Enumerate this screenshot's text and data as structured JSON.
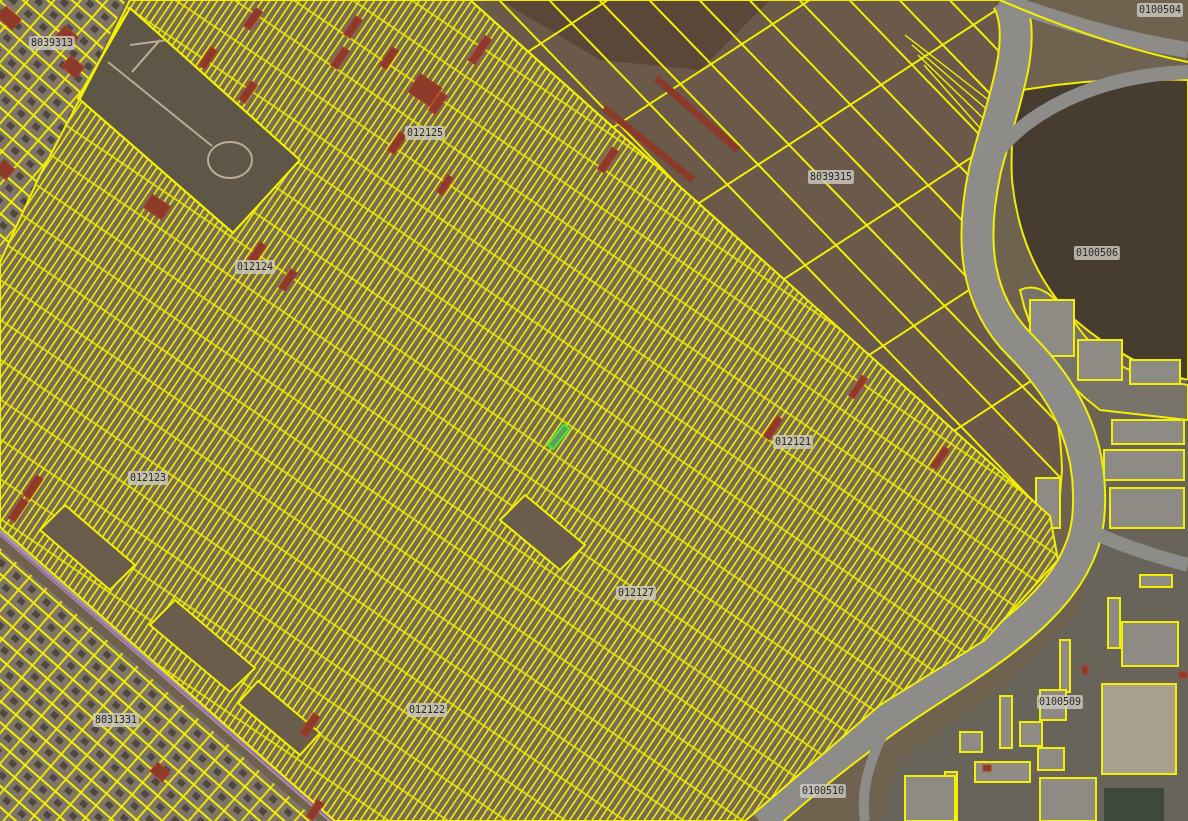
{
  "map": {
    "parcel_numbers": [
      "0100504",
      "8039313",
      "012125",
      "8039315",
      "0100506",
      "012124",
      "012121",
      "012123",
      "012127",
      "0100509",
      "012122",
      "8031331",
      "0100510"
    ]
  }
}
